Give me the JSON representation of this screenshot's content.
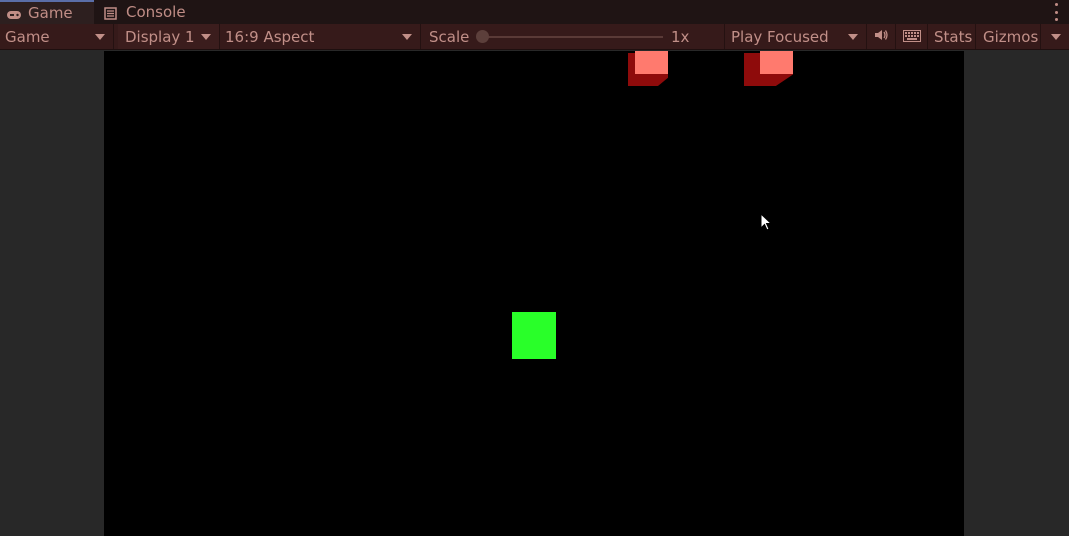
{
  "tabs": [
    {
      "label": "Game",
      "icon": "gamepad-icon",
      "active": true
    },
    {
      "label": "Console",
      "icon": "console-icon",
      "active": false
    }
  ],
  "toolbar": {
    "view_mode": "Game",
    "display": "Display 1",
    "aspect": "16:9 Aspect",
    "scale_label": "Scale",
    "scale_value": "1x",
    "play_mode": "Play Focused",
    "stats_label": "Stats",
    "gizmos_label": "Gizmos",
    "audio_icon": "speaker-icon",
    "keyboard_icon": "keyboard-icon"
  },
  "colors": {
    "accent_tab": "#5a6ea8",
    "toolbar_bg": "#361a1a",
    "text": "#c18f88",
    "player": "#29ff29",
    "enemy_top": "#ff7a6e",
    "enemy_side": "#8e0b0b",
    "viewport_bg": "#000000"
  }
}
